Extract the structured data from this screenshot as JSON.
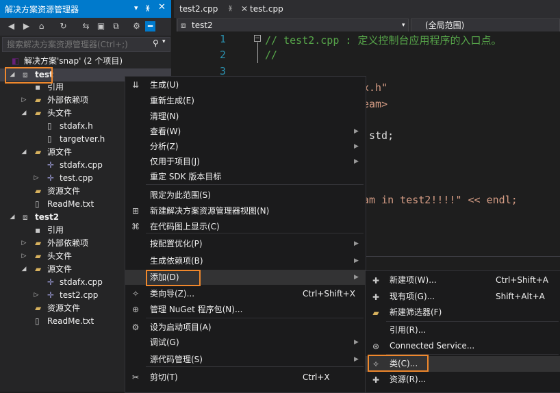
{
  "explorer": {
    "title": "解决方案资源管理器",
    "search_placeholder": "搜索解决方案资源管理器(Ctrl+;)",
    "solution": "解决方案'snap' (2 个项目)",
    "tree": [
      {
        "label": "test",
        "depth": 1
      },
      {
        "label": "引用",
        "depth": 2
      },
      {
        "label": "外部依赖项",
        "depth": 2
      },
      {
        "label": "头文件",
        "depth": 2
      },
      {
        "label": "stdafx.h",
        "depth": 3
      },
      {
        "label": "targetver.h",
        "depth": 3
      },
      {
        "label": "源文件",
        "depth": 2
      },
      {
        "label": "stdafx.cpp",
        "depth": 3
      },
      {
        "label": "test.cpp",
        "depth": 3
      },
      {
        "label": "资源文件",
        "depth": 2
      },
      {
        "label": "ReadMe.txt",
        "depth": 2
      },
      {
        "label": "test2",
        "depth": 1
      },
      {
        "label": "引用",
        "depth": 2
      },
      {
        "label": "外部依赖项",
        "depth": 2
      },
      {
        "label": "头文件",
        "depth": 2
      },
      {
        "label": "源文件",
        "depth": 2
      },
      {
        "label": "stdafx.cpp",
        "depth": 3
      },
      {
        "label": "test2.cpp",
        "depth": 3
      },
      {
        "label": "资源文件",
        "depth": 2
      },
      {
        "label": "ReadMe.txt",
        "depth": 2
      }
    ]
  },
  "editor": {
    "tabs": [
      "test2.cpp",
      "test.cpp"
    ],
    "nav_left": "test2",
    "nav_right": "(全局范围)",
    "line_numbers": [
      "1",
      "2",
      "3"
    ],
    "line1": "// test2.cpp : 定义控制台应用程序的入口点。",
    "line2": "//",
    "frag1": "x.h\"",
    "frag2": "eam>",
    "frag3": "std;",
    "frag4": "am in test2!!!!\" << endl;"
  },
  "context_menu": {
    "items": [
      {
        "label": "生成(U)"
      },
      {
        "label": "重新生成(E)"
      },
      {
        "label": "清理(N)"
      },
      {
        "label": "查看(W)"
      },
      {
        "label": "分析(Z)"
      },
      {
        "label": "仅用于项目(J)"
      },
      {
        "label": "重定 SDK 版本目标"
      },
      {
        "label": "限定为此范围(S)"
      },
      {
        "label": "新建解决方案资源管理器视图(N)"
      },
      {
        "label": "在代码图上显示(C)"
      },
      {
        "label": "按配置优化(P)"
      },
      {
        "label": "生成依赖项(B)"
      },
      {
        "label": "添加(D)"
      },
      {
        "label": "类向导(Z)...",
        "shortcut": "Ctrl+Shift+X"
      },
      {
        "label": "管理 NuGet 程序包(N)..."
      },
      {
        "label": "设为启动项目(A)"
      },
      {
        "label": "调试(G)"
      },
      {
        "label": "源代码管理(S)"
      },
      {
        "label": "剪切(T)",
        "shortcut": "Ctrl+X"
      }
    ]
  },
  "submenu": {
    "items": [
      {
        "label": "新建项(W)...",
        "shortcut": "Ctrl+Shift+A"
      },
      {
        "label": "现有项(G)...",
        "shortcut": "Shift+Alt+A"
      },
      {
        "label": "新建筛选器(F)",
        "shortcut": ""
      },
      {
        "label": "引用(R)...",
        "shortcut": ""
      },
      {
        "label": "Connected Service...",
        "shortcut": ""
      },
      {
        "label": "类(C)...",
        "shortcut": ""
      },
      {
        "label": "资源(R)...",
        "shortcut": ""
      }
    ]
  },
  "colors": {
    "accent": "#007acc",
    "highlight_box": "#f0882c"
  }
}
